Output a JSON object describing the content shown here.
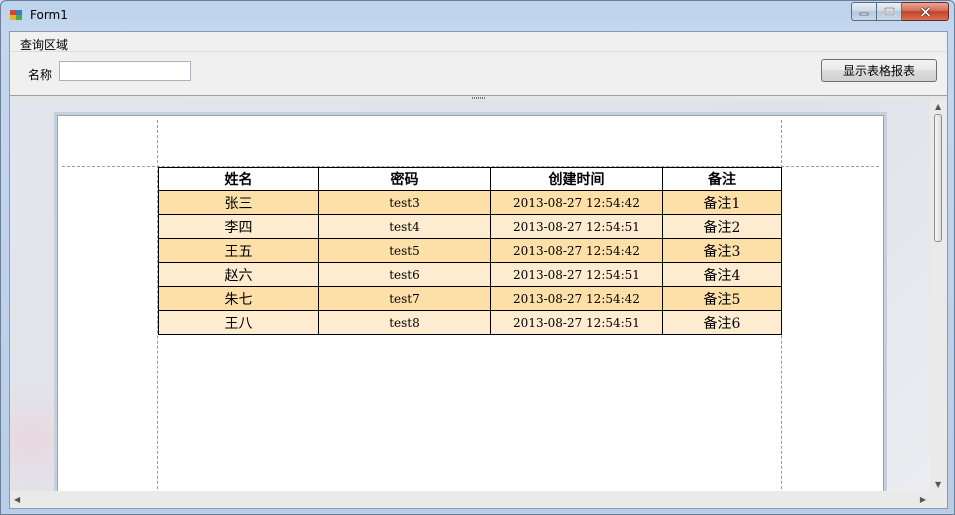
{
  "window": {
    "title": "Form1",
    "close_color": "#c2442b"
  },
  "query_area": {
    "title": "查询区域",
    "name_label": "名称",
    "name_value": "",
    "show_button_label": "显示表格报表"
  },
  "report": {
    "columns": [
      "姓名",
      "密码",
      "创建时间",
      "备注"
    ],
    "rows": [
      {
        "name": "张三",
        "password": "test3",
        "created": "2013-08-27 12:54:42",
        "note": "备注1"
      },
      {
        "name": "李四",
        "password": "test4",
        "created": "2013-08-27 12:54:51",
        "note": "备注2"
      },
      {
        "name": "王五",
        "password": "test5",
        "created": "2013-08-27 12:54:42",
        "note": "备注3"
      },
      {
        "name": "赵六",
        "password": "test6",
        "created": "2013-08-27 12:54:51",
        "note": "备注4"
      },
      {
        "name": "朱七",
        "password": "test7",
        "created": "2013-08-27 12:54:42",
        "note": "备注5"
      },
      {
        "name": "王八",
        "password": "test8",
        "created": "2013-08-27 12:54:51",
        "note": "备注6"
      }
    ],
    "row_colors": [
      "#fddfa8",
      "#fdecd0"
    ]
  },
  "icons": {
    "app": "form-app-icon",
    "minimize": "minimize-icon",
    "maximize": "maximize-icon",
    "close": "close-icon"
  }
}
